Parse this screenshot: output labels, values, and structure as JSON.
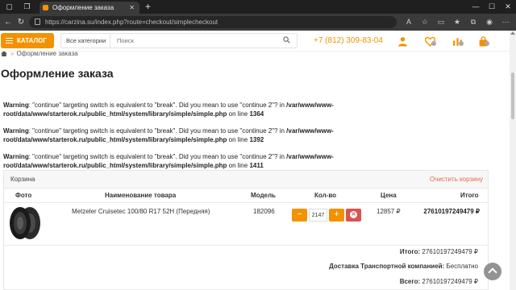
{
  "browser": {
    "tab_title": "Оформление заказа",
    "tab_close": "✕",
    "new_tab": "+",
    "url": "https://carzina.su/index.php?route=checkout/simplecheckout"
  },
  "header": {
    "catalog_label": "КАТАЛОГ",
    "search_category": "Все категории",
    "search_placeholder": "Поиск",
    "phone": "+7 (812) 309-83-04",
    "accent_color": "#f39200"
  },
  "breadcrumb": {
    "current": "Оформление заказа"
  },
  "page": {
    "title": "Оформление заказа"
  },
  "warnings": [
    {
      "label": "Warning",
      "text": ": \"continue\" targeting switch is equivalent to \"break\". Did you mean to use \"continue 2\"? in ",
      "path": "/var/www/www-root/data/www/starterok.ru/public_html/system/library/simple/simple.php",
      "line_text": " on line ",
      "line": "1364"
    },
    {
      "label": "Warning",
      "text": ": \"continue\" targeting switch is equivalent to \"break\". Did you mean to use \"continue 2\"? in ",
      "path": "/var/www/www-root/data/www/starterok.ru/public_html/system/library/simple/simple.php",
      "line_text": " on line ",
      "line": "1392"
    },
    {
      "label": "Warning",
      "text": ": \"continue\" targeting switch is equivalent to \"break\". Did you mean to use \"continue 2\"? in ",
      "path": "/var/www/www-root/data/www/starterok.ru/public_html/system/library/simple/simple.php",
      "line_text": " on line ",
      "line": "1411"
    }
  ],
  "cart": {
    "title": "Корзина",
    "clear_label": "Очистить корзину",
    "columns": {
      "photo": "Фото",
      "name": "Наименование товара",
      "model": "Модель",
      "qty": "Кол-во",
      "price": "Цена",
      "total": "Итого"
    },
    "item": {
      "name": "Metzeler Cruisetec 100/80 R17 52H (Передняя)",
      "model": "182096",
      "qty": "2147",
      "price": "12857 ₽",
      "total": "27610197249479 ₽",
      "minus": "−",
      "plus": "+",
      "remove": "✕"
    },
    "summary": {
      "subtotal_label": "Итого:",
      "subtotal_value": "27610197249479 ₽",
      "delivery_label": "Доставка Транспортной компанией:",
      "delivery_value": "Бесплатно",
      "grand_label": "Всего:",
      "grand_value": "27610197249479 ₽"
    }
  }
}
